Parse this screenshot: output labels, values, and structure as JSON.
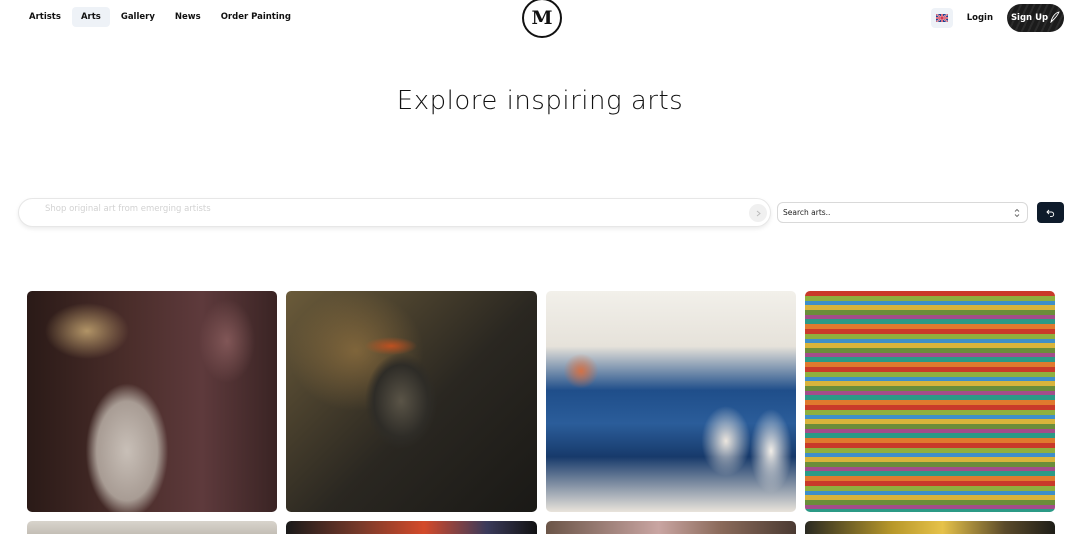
{
  "header": {
    "nav": [
      {
        "label": "Artists",
        "active": false
      },
      {
        "label": "Arts",
        "active": true
      },
      {
        "label": "Gallery",
        "active": false
      },
      {
        "label": "News",
        "active": false
      },
      {
        "label": "Order Painting",
        "active": false
      }
    ],
    "logo_letter": "M",
    "language_icon": "uk-flag-icon",
    "login_label": "Login",
    "signup_label": "Sign Up"
  },
  "hero": {
    "title": "Explore inspiring arts"
  },
  "search": {
    "placeholder": "Shop original art from emerging artists",
    "value": "",
    "submit_icon": "arrow-right-icon"
  },
  "filter": {
    "selected": "Search arts..",
    "icon": "sort-arrows-icon"
  },
  "reset": {
    "icon": "undo-icon"
  },
  "colors": {
    "accent_dark": "#0e1b2b",
    "signup_bg": "#1b1b1b",
    "nav_active_bg": "#eef2f7"
  },
  "artworks": [
    {
      "subject": "figure-bare-back-painting"
    },
    {
      "subject": "dark-portrait-with-crown-painting"
    },
    {
      "subject": "blue-abstract-figures-painting"
    },
    {
      "subject": "colorful-horizontal-stripes-painting"
    },
    {
      "subject": "grey-landscape-sketch"
    },
    {
      "subject": "red-abstract-painting"
    },
    {
      "subject": "pink-floral-painting"
    },
    {
      "subject": "yellow-abstract-painting"
    }
  ]
}
